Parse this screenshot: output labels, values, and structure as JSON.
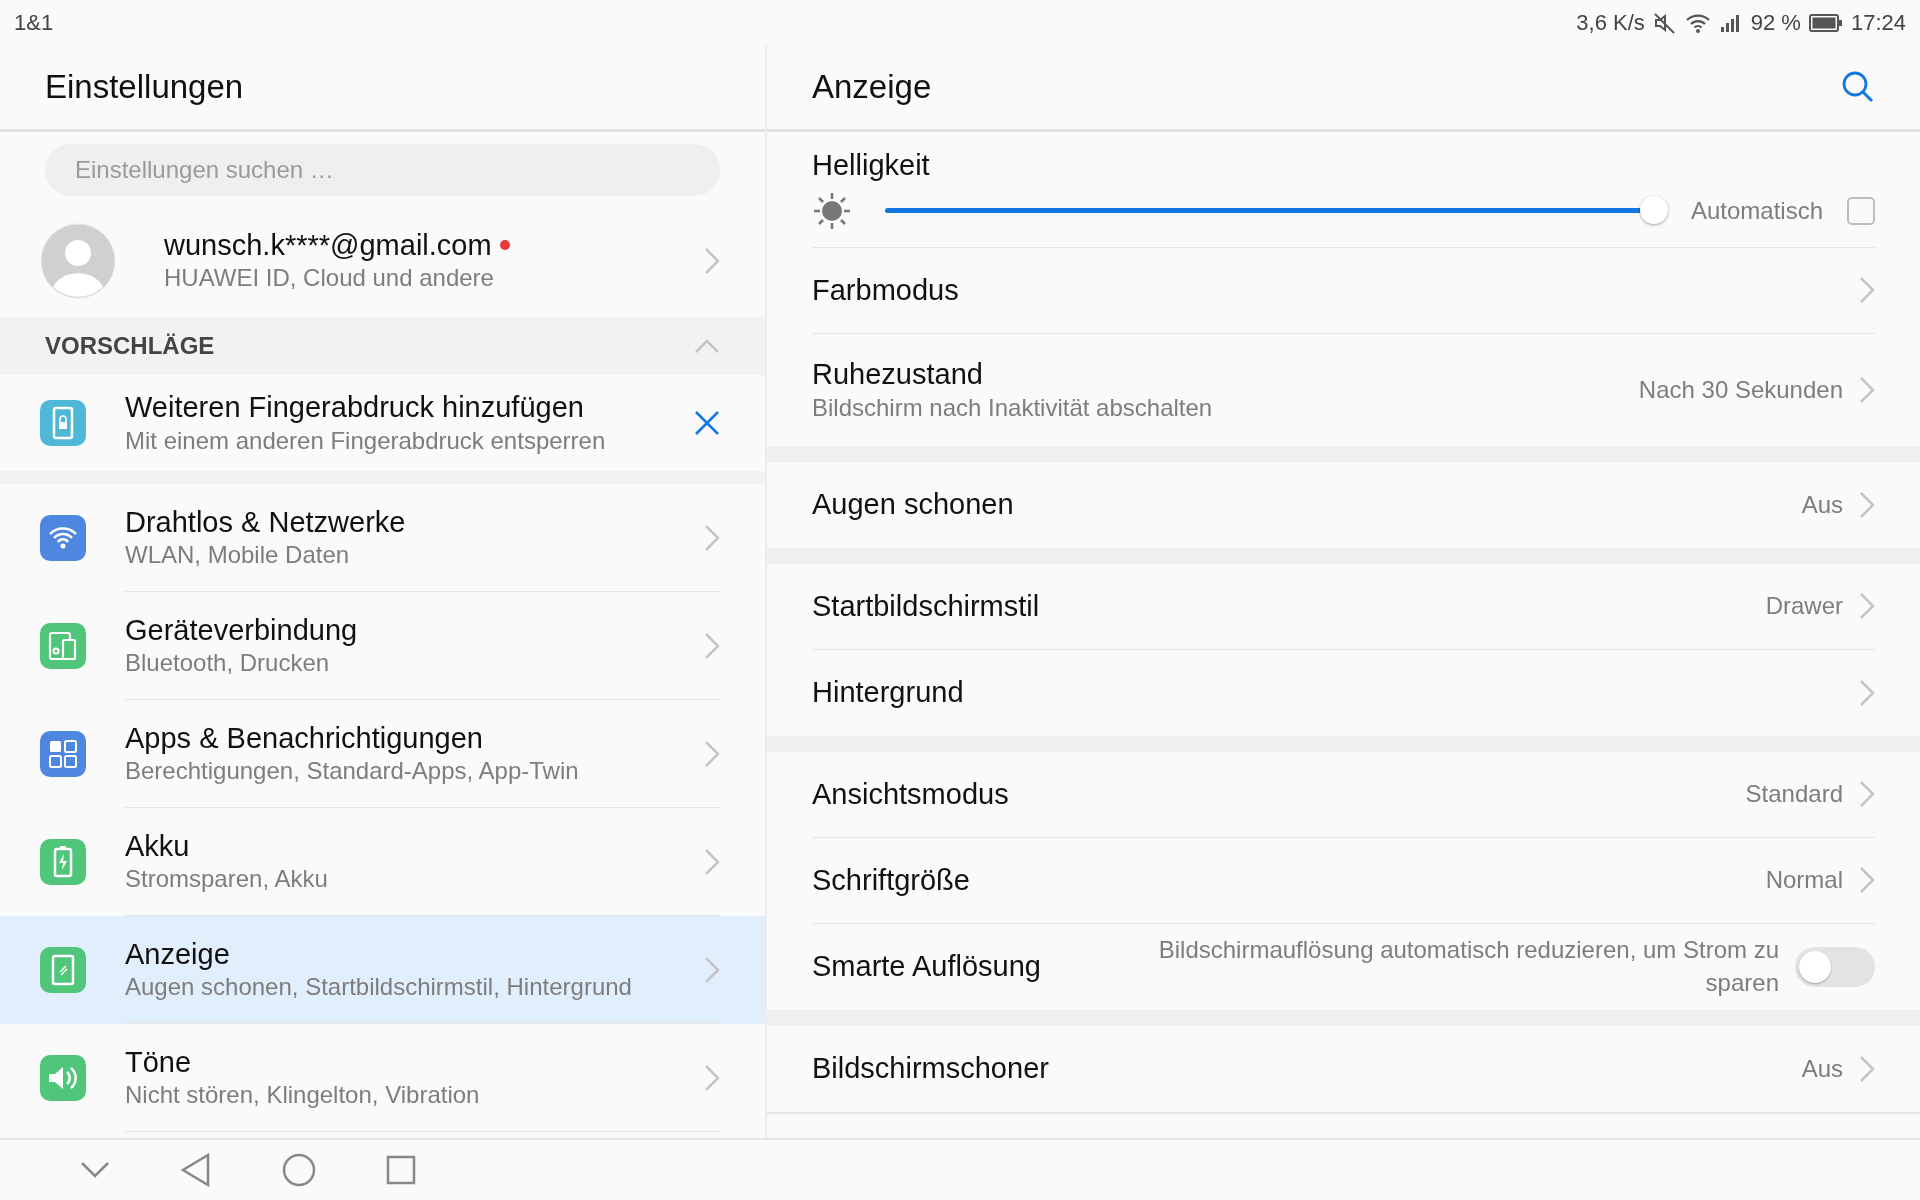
{
  "status_bar": {
    "carrier": "1&1",
    "speed": "3,6 K/s",
    "battery": "92 %",
    "time": "17:24"
  },
  "left": {
    "title": "Einstellungen",
    "search": {
      "placeholder": "Einstellungen suchen …"
    },
    "account": {
      "email": "wunsch.k****@gmail.com",
      "subtitle": "HUAWEI ID, Cloud und andere",
      "notification": true
    },
    "suggestions": {
      "title": "VORSCHLÄGE",
      "expanded": true,
      "items": [
        {
          "title": "Weiteren Fingerabdruck hinzufügen",
          "subtitle": "Mit einem anderen Fingerabdruck entsperren",
          "color": "#4fb8d6"
        }
      ]
    },
    "items": [
      {
        "title": "Drahtlos & Netzwerke",
        "subtitle": "WLAN, Mobile Daten",
        "color": "#4f86e0",
        "selected": false
      },
      {
        "title": "Geräteverbindung",
        "subtitle": "Bluetooth, Drucken",
        "color": "#4fc67a",
        "selected": false
      },
      {
        "title": "Apps & Benachrichtigungen",
        "subtitle": "Berechtigungen, Standard-Apps, App-Twin",
        "color": "#4f86e0",
        "selected": false
      },
      {
        "title": "Akku",
        "subtitle": "Stromsparen, Akku",
        "color": "#4fc67a",
        "selected": false
      },
      {
        "title": "Anzeige",
        "subtitle": "Augen schonen, Startbildschirmstil, Hintergrund",
        "color": "#4fc67a",
        "selected": true
      },
      {
        "title": "Töne",
        "subtitle": "Nicht stören, Klingelton, Vibration",
        "color": "#4fc67a",
        "selected": false
      }
    ]
  },
  "right": {
    "title": "Anzeige",
    "groups": [
      {
        "rows": [
          {
            "kind": "slider",
            "title": "Helligkeit",
            "level": 1.0,
            "auto_label": "Automatisch",
            "auto_checked": false
          },
          {
            "kind": "nav",
            "title": "Farbmodus"
          },
          {
            "kind": "nav",
            "title": "Ruhezustand",
            "subtitle": "Bildschirm nach Inaktivität abschalten",
            "value": "Nach 30 Sekunden"
          }
        ]
      },
      {
        "rows": [
          {
            "kind": "nav",
            "title": "Augen schonen",
            "value": "Aus"
          }
        ]
      },
      {
        "rows": [
          {
            "kind": "nav",
            "title": "Startbildschirmstil",
            "value": "Drawer"
          },
          {
            "kind": "nav",
            "title": "Hintergrund"
          }
        ]
      },
      {
        "rows": [
          {
            "kind": "nav",
            "title": "Ansichtsmodus",
            "value": "Standard"
          },
          {
            "kind": "nav",
            "title": "Schriftgröße",
            "value": "Normal"
          },
          {
            "kind": "toggle",
            "title": "Smarte Auflösung",
            "description": "Bildschirmauflösung automatisch reduzieren, um Strom zu sparen",
            "on": false
          }
        ]
      },
      {
        "rows": [
          {
            "kind": "nav",
            "title": "Bildschirmschoner",
            "value": "Aus"
          }
        ]
      }
    ]
  }
}
